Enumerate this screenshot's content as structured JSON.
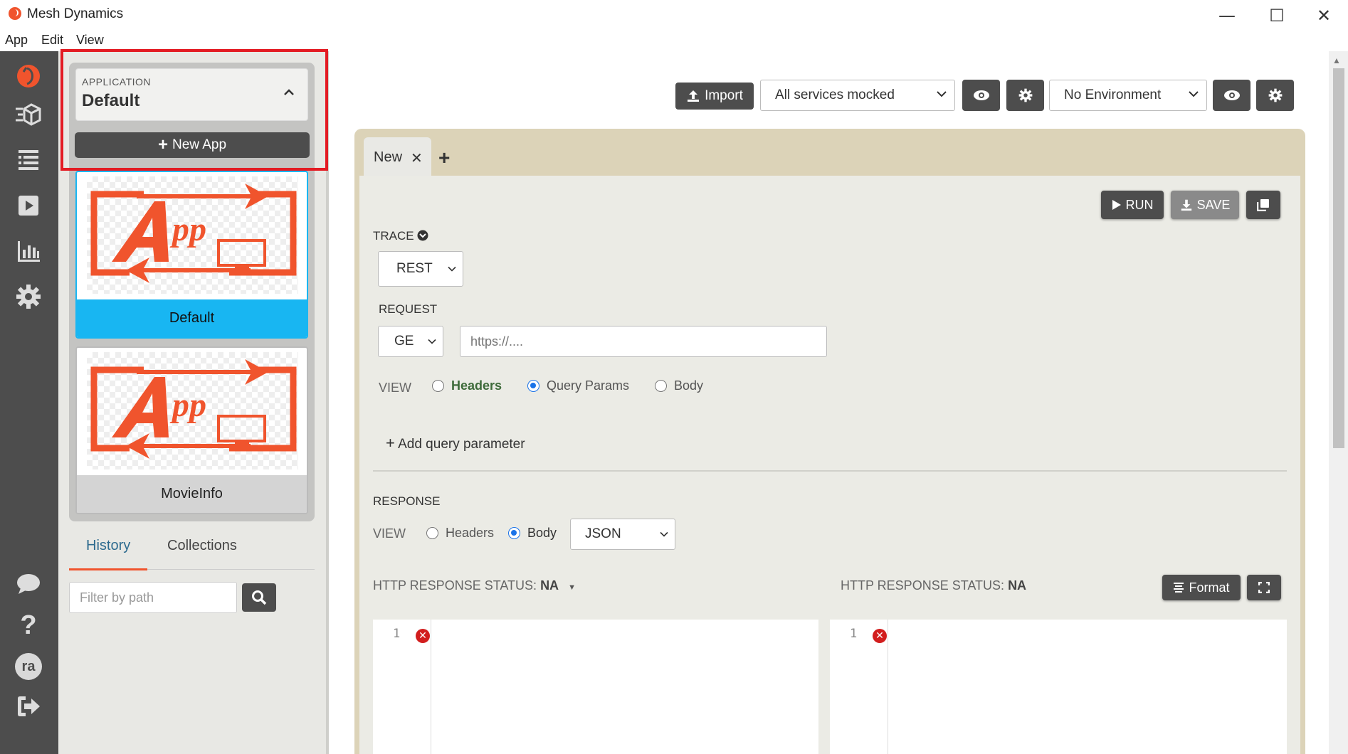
{
  "window": {
    "title": "Mesh Dynamics",
    "minimize_glyph": "—",
    "maximize_glyph": "☐",
    "close_glyph": "✕"
  },
  "menu": [
    "App",
    "Edit",
    "View"
  ],
  "rail": {
    "icons": [
      "logo-icon",
      "services-icon",
      "list-icon",
      "play-icon",
      "chart-icon",
      "settings-icon",
      "chat-icon",
      "help-icon",
      "avatar",
      "logout-icon"
    ],
    "avatar_initials": "ra"
  },
  "sidebar": {
    "app_selector_label": "APPLICATION",
    "app_selector_value": "Default",
    "new_app_label": "New App",
    "apps": [
      {
        "name": "Default",
        "selected": true
      },
      {
        "name": "MovieInfo",
        "selected": false
      }
    ],
    "tabs": [
      {
        "label": "History",
        "active": true
      },
      {
        "label": "Collections",
        "active": false
      }
    ],
    "filter_placeholder": "Filter by path"
  },
  "toolbar": {
    "import_label": "Import",
    "mock_select_value": "All services mocked",
    "env_select_value": "No Environment"
  },
  "editor": {
    "tab_label": "New",
    "run_label": "RUN",
    "save_label": "SAVE",
    "trace_label": "TRACE",
    "trace_type": "REST",
    "request_label": "REQUEST",
    "method": "GE",
    "url_placeholder": "https://....",
    "view_label": "VIEW",
    "request_view_options": [
      {
        "label": "Headers",
        "selected": false
      },
      {
        "label": "Query Params",
        "selected": true
      },
      {
        "label": "Body",
        "selected": false
      }
    ],
    "add_query_param": "Add query parameter",
    "response_label": "RESPONSE",
    "response_view_options": [
      {
        "label": "Headers",
        "selected": false
      },
      {
        "label": "Body",
        "selected": true
      }
    ],
    "response_format": "JSON",
    "status_left_label": "HTTP RESPONSE STATUS:",
    "status_left_value": "NA",
    "status_right_label": "HTTP RESPONSE STATUS:",
    "status_right_value": "NA",
    "format_label": "Format",
    "line_number": "1"
  },
  "colors": {
    "accent_orange": "#f0542d",
    "selected_blue": "#18b6f2",
    "rail_gray": "#4d4d4d",
    "highlight_red": "#e31b23",
    "editor_tan": "#dcd3b8"
  }
}
